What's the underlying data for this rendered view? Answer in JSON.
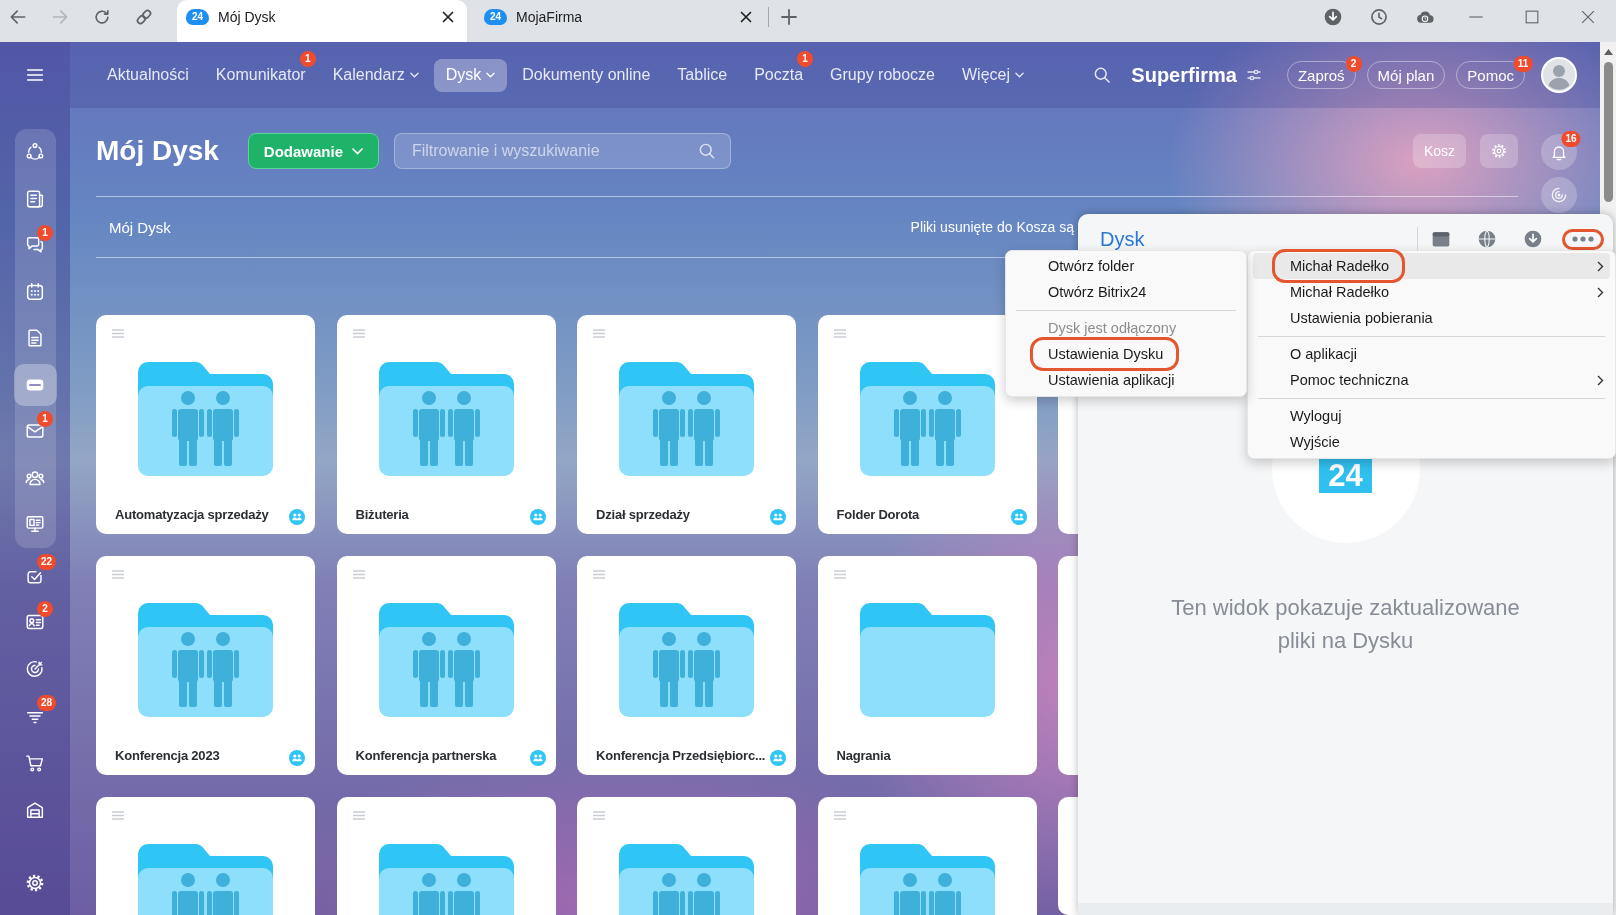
{
  "browser": {
    "forward_disabled": true,
    "tabs": [
      {
        "title": "Mój Dysk",
        "favicon_text": "24",
        "selected": true
      },
      {
        "title": "MojaFirma",
        "favicon_text": "24",
        "selected": false
      }
    ]
  },
  "sidebar": {
    "pinned_items": [
      {
        "selected": false
      },
      {
        "selected": false
      },
      {
        "selected": false,
        "badge": "1"
      },
      {
        "selected": false
      },
      {
        "selected": false
      },
      {
        "selected": true
      },
      {
        "selected": false,
        "badge": "1"
      },
      {
        "selected": false
      },
      {
        "selected": false
      }
    ],
    "items": [
      {
        "selected": false,
        "badge": "22"
      },
      {
        "selected": false,
        "badge": "2"
      },
      {
        "selected": false
      },
      {
        "selected": false,
        "badge": "28"
      },
      {
        "selected": false
      },
      {
        "selected": false
      }
    ],
    "footer_items": [
      {
        "selected": false
      }
    ]
  },
  "top_nav": {
    "items": [
      {
        "label": "Aktualności",
        "selected": false,
        "dropdown": false
      },
      {
        "label": "Komunikator",
        "selected": false,
        "dropdown": false,
        "badge": "1"
      },
      {
        "label": "Kalendarz",
        "selected": false,
        "dropdown": true
      },
      {
        "label": "Dysk",
        "selected": true,
        "dropdown": true
      },
      {
        "label": "Dokumenty online",
        "selected": false,
        "dropdown": false
      },
      {
        "label": "Tablice",
        "selected": false,
        "dropdown": false
      },
      {
        "label": "Poczta",
        "selected": false,
        "dropdown": false,
        "badge": "1"
      },
      {
        "label": "Grupy robocze",
        "selected": false,
        "dropdown": false
      },
      {
        "label": "Więcej",
        "selected": false,
        "dropdown": true
      }
    ],
    "company": "Superfirma",
    "buttons": [
      {
        "label": "Zaproś",
        "badge": "2"
      },
      {
        "label": "Mój plan"
      },
      {
        "label": "Pomoc",
        "badge": "11"
      }
    ]
  },
  "drive": {
    "title": "Mój Dysk",
    "add_button": "Dodawanie",
    "search": {
      "placeholder": "Filtrowanie i wyszukiwanie"
    },
    "trash_button": "Kosz",
    "notifications_badge": "16",
    "breadcrumb": "Mój Dysk",
    "notice": "Pliki usunięte do Kosza są",
    "folders": [
      {
        "kind": "folder",
        "name": "Automatyzacja sprzedaży",
        "shared": true
      },
      {
        "kind": "folder",
        "name": "Biżuteria",
        "shared": true
      },
      {
        "kind": "folder",
        "name": "Dział sprzedaży",
        "shared": true
      },
      {
        "kind": "folder",
        "name": "Folder Dorota",
        "shared": true
      },
      {
        "kind": "edge"
      },
      {
        "kind": "folder",
        "name": "Konferencja 2023",
        "shared": true
      },
      {
        "kind": "folder",
        "name": "Konferencja partnerska",
        "shared": true
      },
      {
        "kind": "folder",
        "name": "Konferencja Przedsiębiorc...",
        "shared": true
      },
      {
        "kind": "folder",
        "name": "Nagrania",
        "shared": false
      },
      {
        "kind": "edge"
      },
      {
        "kind": "folder",
        "shared": true
      },
      {
        "kind": "folder",
        "shared": true
      },
      {
        "kind": "folder",
        "shared": true
      },
      {
        "kind": "folder",
        "shared": true
      },
      {
        "kind": "edge"
      }
    ]
  },
  "desktop_app": {
    "title": "Dysk",
    "more_button": {
      "highlighted": true
    },
    "logo_text": "24",
    "message": "Ten widok pokazuje zaktualizowane pliki na Dysku"
  },
  "context_menu": {
    "items": [
      {
        "kind": "item",
        "label": "Michał Radełko",
        "submenu": true,
        "selected": true,
        "disabled": false,
        "highlighted": true,
        "submenu_items": [
          {
            "kind": "item",
            "label": "Otwórz folder",
            "submenu": false,
            "selected": false,
            "disabled": false,
            "highlighted": false
          },
          {
            "kind": "item",
            "label": "Otwórz Bitrix24",
            "submenu": false,
            "selected": false,
            "disabled": false,
            "highlighted": false
          },
          {
            "kind": "separator"
          },
          {
            "kind": "item",
            "label": "Dysk jest odłączony",
            "submenu": false,
            "selected": false,
            "disabled": true,
            "highlighted": false
          },
          {
            "kind": "item",
            "label": "Ustawienia Dysku",
            "submenu": false,
            "selected": false,
            "disabled": false,
            "highlighted": true
          },
          {
            "kind": "item",
            "label": "Ustawienia aplikacji",
            "submenu": false,
            "selected": false,
            "disabled": false,
            "highlighted": false
          }
        ]
      },
      {
        "kind": "item",
        "label": "Michał Radełko",
        "submenu": true,
        "selected": false,
        "disabled": false,
        "highlighted": false
      },
      {
        "kind": "item",
        "label": "Ustawienia pobierania",
        "submenu": false,
        "selected": false,
        "disabled": false,
        "highlighted": false
      },
      {
        "kind": "separator"
      },
      {
        "kind": "item",
        "label": "O aplikacji",
        "submenu": false,
        "selected": false,
        "disabled": false,
        "highlighted": false
      },
      {
        "kind": "item",
        "label": "Pomoc techniczna",
        "submenu": true,
        "selected": false,
        "disabled": false,
        "highlighted": false
      },
      {
        "kind": "separator"
      },
      {
        "kind": "item",
        "label": "Wyloguj",
        "submenu": false,
        "selected": false,
        "disabled": false,
        "highlighted": false
      },
      {
        "kind": "item",
        "label": "Wyjście",
        "submenu": false,
        "selected": false,
        "disabled": false,
        "highlighted": false
      }
    ]
  }
}
